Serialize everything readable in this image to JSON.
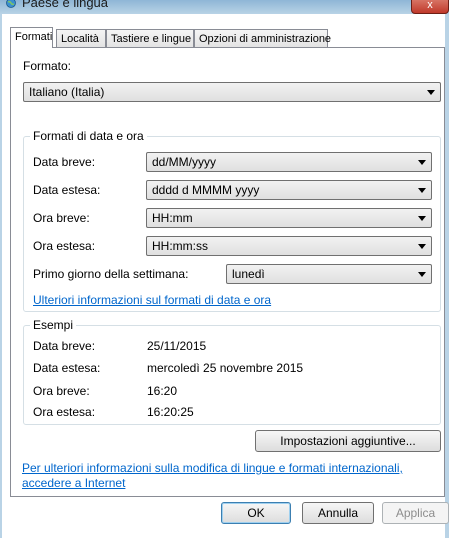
{
  "window": {
    "title": "Paese e lingua",
    "close": "x"
  },
  "tabs": [
    {
      "label": "Formati"
    },
    {
      "label": "Località"
    },
    {
      "label": "Tastiere e lingue"
    },
    {
      "label": "Opzioni di amministrazione"
    }
  ],
  "format": {
    "label": "Formato:",
    "value": "Italiano (Italia)"
  },
  "datetime_group": {
    "title": "Formati di data e ora",
    "short_date": {
      "label": "Data breve:",
      "value": "dd/MM/yyyy"
    },
    "long_date": {
      "label": "Data estesa:",
      "value": "dddd d MMMM yyyy"
    },
    "short_time": {
      "label": "Ora breve:",
      "value": "HH:mm"
    },
    "long_time": {
      "label": "Ora estesa:",
      "value": "HH:mm:ss"
    },
    "first_day": {
      "label": "Primo giorno della settimana:",
      "value": "lunedì"
    },
    "link": "Ulteriori informazioni sul formati di data e ora"
  },
  "examples": {
    "title": "Esempi",
    "rows": [
      {
        "label": "Data breve:",
        "value": "25/11/2015"
      },
      {
        "label": "Data estesa:",
        "value": "mercoledì 25 novembre 2015"
      },
      {
        "label": "Ora breve:",
        "value": "16:20"
      },
      {
        "label": "Ora estesa:",
        "value": "16:20:25"
      }
    ]
  },
  "additional_settings": "Impostazioni aggiuntive...",
  "footer_link": {
    "line1": "Per ulteriori informazioni sulla modifica di lingue e formati internazionali,",
    "line2": "accedere a Internet"
  },
  "buttons": {
    "ok": "OK",
    "cancel": "Annulla",
    "apply": "Applica"
  }
}
